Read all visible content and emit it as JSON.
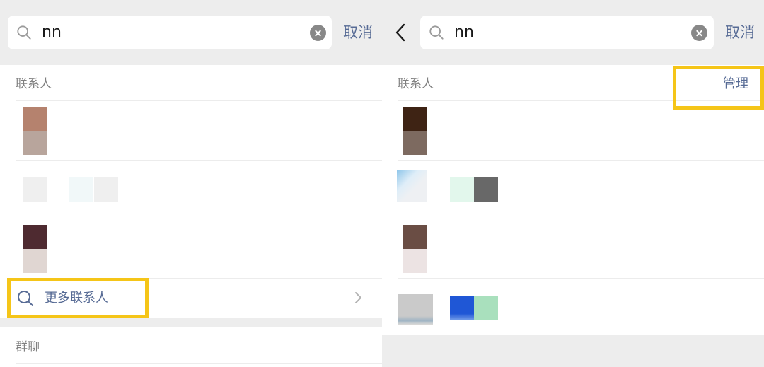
{
  "left": {
    "search": {
      "query": "nn",
      "cancel_label": "取消"
    },
    "contacts_section": {
      "label": "联系人"
    },
    "more_contacts_label": "更多联系人",
    "group_section": {
      "label": "群聊"
    }
  },
  "right": {
    "search": {
      "query": "nn",
      "cancel_label": "取消"
    },
    "contacts_section": {
      "label": "联系人",
      "manage_label": "管理"
    }
  },
  "colors": {
    "background": "#ededed",
    "link": "#576b95",
    "highlight": "#f5c518",
    "clear_icon": "#888888"
  },
  "icons": [
    "search-icon",
    "clear-icon",
    "back-icon",
    "chevron-right-icon"
  ]
}
